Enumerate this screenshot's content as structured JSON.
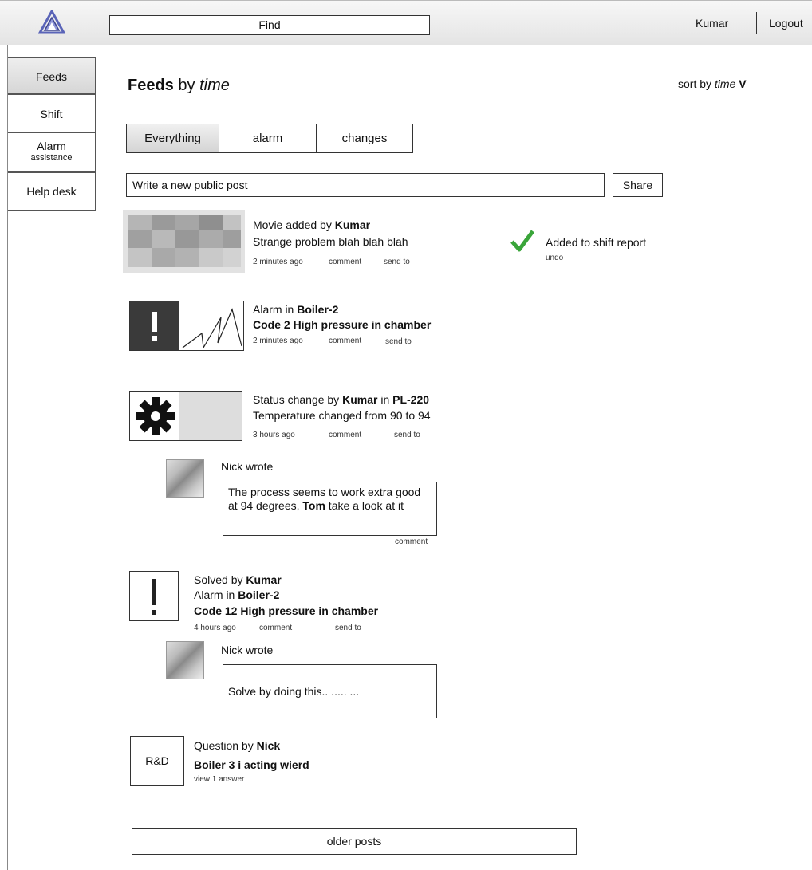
{
  "header": {
    "search_placeholder": "Find",
    "user_name": "Kumar",
    "logout_label": "Logout"
  },
  "sidebar": {
    "items": [
      {
        "label": "Feeds",
        "sub": ""
      },
      {
        "label": "Shift",
        "sub": ""
      },
      {
        "label": "Alarm",
        "sub": "assistance"
      },
      {
        "label": "Help desk",
        "sub": ""
      }
    ]
  },
  "page": {
    "title_bold": "Feeds",
    "title_mid": " by ",
    "title_italic": "time",
    "sort_prefix": "sort by ",
    "sort_value": "time",
    "sort_caret": "V"
  },
  "tabs": [
    "Everything",
    "alarm",
    "changes"
  ],
  "composer": {
    "placeholder": "Write a new public post",
    "share_label": "Share"
  },
  "feed": {
    "p1": {
      "line1_prefix": "Movie added by ",
      "line1_bold": "Kumar",
      "line2": "Strange problem blah blah blah",
      "time": "2 minutes ago",
      "comment": "comment",
      "send": "send to",
      "status": "Added to shift report",
      "undo": "undo"
    },
    "p2": {
      "line1_prefix": "Alarm in ",
      "line1_bold": "Boiler-2",
      "line2": "Code 2 High pressure in chamber",
      "time": "2 minutes ago",
      "comment": "comment",
      "send": "send to"
    },
    "p3": {
      "a": "Status change by ",
      "b": "Kumar",
      "c": " in ",
      "d": "PL-220",
      "line2": "Temperature changed from 90 to 94",
      "time": "3 hours ago",
      "comment": "comment",
      "send": "send to",
      "reply": {
        "author": "Nick wrote",
        "text_a": "The process seems to work extra good at 94 degrees, ",
        "text_bold": "Tom",
        "text_b": " take a look at it",
        "comment": "comment"
      }
    },
    "p4": {
      "line1_prefix": "Solved by ",
      "line1_bold": "Kumar",
      "line2_prefix": "Alarm in ",
      "line2_bold": "Boiler-2",
      "line3": "Code 12 High pressure in chamber",
      "time": "4 hours ago",
      "comment": "comment",
      "send": "send to",
      "reply": {
        "author": "Nick wrote",
        "text": "Solve by doing this.. ..... ..."
      }
    },
    "p5": {
      "badge": "R&D",
      "line1_prefix": "Question by ",
      "line1_bold": "Nick",
      "line2": "Boiler 3 i acting wierd",
      "view": "view 1 answer"
    }
  },
  "older_label": "older posts"
}
